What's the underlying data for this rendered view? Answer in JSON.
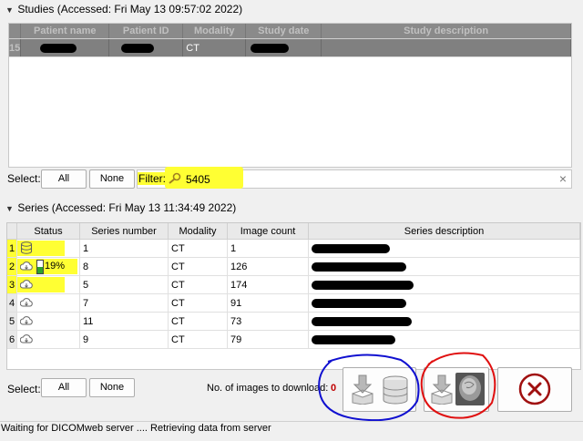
{
  "studies": {
    "title": "Studies (Accessed: Fri May 13 09:57:02 2022)",
    "columns": [
      "Patient name",
      "Patient ID",
      "Modality",
      "Study date",
      "Study description"
    ],
    "rows": [
      {
        "num": "15",
        "modality": "CT"
      }
    ],
    "select_label": "Select:",
    "all_label": "All",
    "none_label": "None",
    "filter_label": "Filter:",
    "filter_value": "5405",
    "clear_icon": "×"
  },
  "series": {
    "title": "Series (Accessed: Fri May 13 11:34:49 2022)",
    "columns": [
      "Status",
      "Series number",
      "Modality",
      "Image count",
      "Series description"
    ],
    "rows": [
      {
        "num": "1",
        "status": "database",
        "series_number": "1",
        "modality": "CT",
        "image_count": "1"
      },
      {
        "num": "2",
        "status": "downloading",
        "progress_label": "19%",
        "progress": 0.19,
        "series_number": "8",
        "modality": "CT",
        "image_count": "126"
      },
      {
        "num": "3",
        "status": "cloud",
        "series_number": "5",
        "modality": "CT",
        "image_count": "174"
      },
      {
        "num": "4",
        "status": "cloud",
        "series_number": "7",
        "modality": "CT",
        "image_count": "91"
      },
      {
        "num": "5",
        "status": "cloud",
        "series_number": "11",
        "modality": "CT",
        "image_count": "73"
      },
      {
        "num": "6",
        "status": "cloud",
        "series_number": "9",
        "modality": "CT",
        "image_count": "79"
      }
    ],
    "select_label": "Select:",
    "all_label": "All",
    "none_label": "None",
    "download_count_label": "No. of images to download:",
    "download_count": "0"
  },
  "status_bar": {
    "message": "Waiting for DICOMweb server .... Retrieving data from server"
  },
  "colors": {
    "highlight": "#ffff33",
    "annotation_blue": "#1010d0",
    "annotation_red": "#e01010",
    "close_red": "#a01010",
    "count_red": "#c00000"
  }
}
